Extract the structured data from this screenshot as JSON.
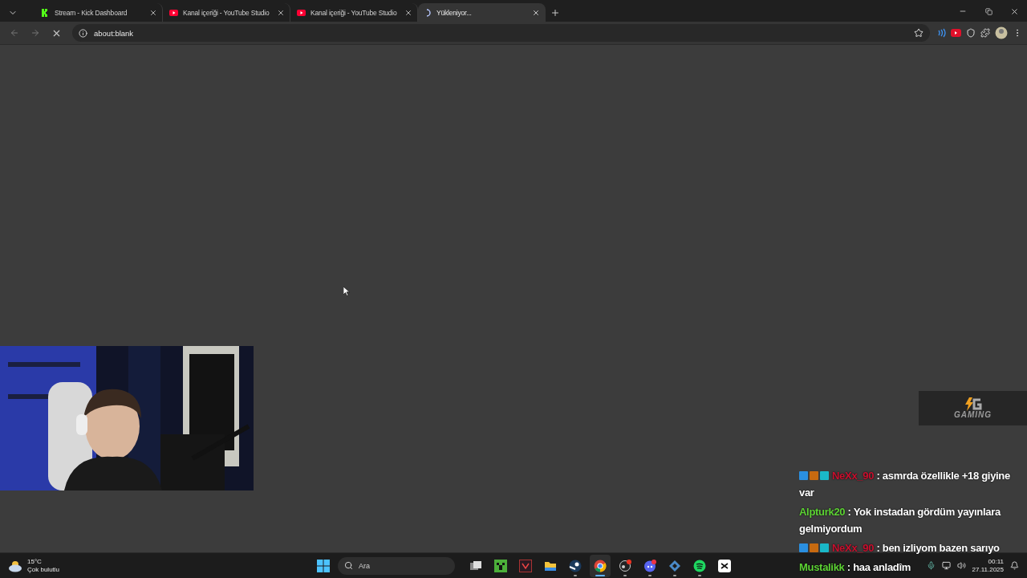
{
  "tabs": [
    {
      "title": "Stream - Kick Dashboard",
      "kind": "kick",
      "selected": false
    },
    {
      "title": "Kanal içeriği - YouTube Studio",
      "kind": "youtube",
      "selected": false
    },
    {
      "title": "Kanal içeriği - YouTube Studio",
      "kind": "youtube",
      "selected": false
    },
    {
      "title": "Yükleniyor...",
      "kind": "loading",
      "selected": true
    }
  ],
  "address_bar": {
    "url": "about:blank"
  },
  "overlay": {
    "logo": "GAMING",
    "chat": [
      {
        "badges": true,
        "user": "NeXx_90",
        "color": "#c8102e",
        "separator": ":",
        "text": "asmrda özellikle +18 giyine var"
      },
      {
        "badges": false,
        "user": "Alpturk20",
        "color": "#5dd334",
        "separator": ":",
        "text": "Yok instadan gördüm yayınlara gelmiyordum"
      },
      {
        "badges": true,
        "user": "NeXx_90",
        "color": "#c8102e",
        "separator": ":",
        "text": "ben izliyom bazen sarıyo"
      },
      {
        "badges": false,
        "user": "Mustalikk",
        "color": "#5dd334",
        "separator": ":",
        "text": "haa anladîm"
      }
    ]
  },
  "taskbar": {
    "weather": {
      "temp": "15°C",
      "condition": "Çok bulutlu"
    },
    "search": {
      "placeholder": "Ara"
    },
    "apps": [
      {
        "kind": "taskview",
        "running": false,
        "active": false
      },
      {
        "kind": "minecraft",
        "running": false,
        "active": false
      },
      {
        "kind": "valorant",
        "running": false,
        "active": false
      },
      {
        "kind": "folder",
        "running": false,
        "active": false
      },
      {
        "kind": "steam",
        "running": true,
        "active": false
      },
      {
        "kind": "chrome",
        "running": true,
        "active": true
      },
      {
        "kind": "obs",
        "running": true,
        "active": false
      },
      {
        "kind": "discord",
        "running": true,
        "active": false
      },
      {
        "kind": "cube",
        "running": true,
        "active": false
      },
      {
        "kind": "spotify",
        "running": true,
        "active": false
      },
      {
        "kind": "capcut",
        "running": false,
        "active": false
      }
    ],
    "time": "00:11",
    "date": "27.11.2025"
  }
}
